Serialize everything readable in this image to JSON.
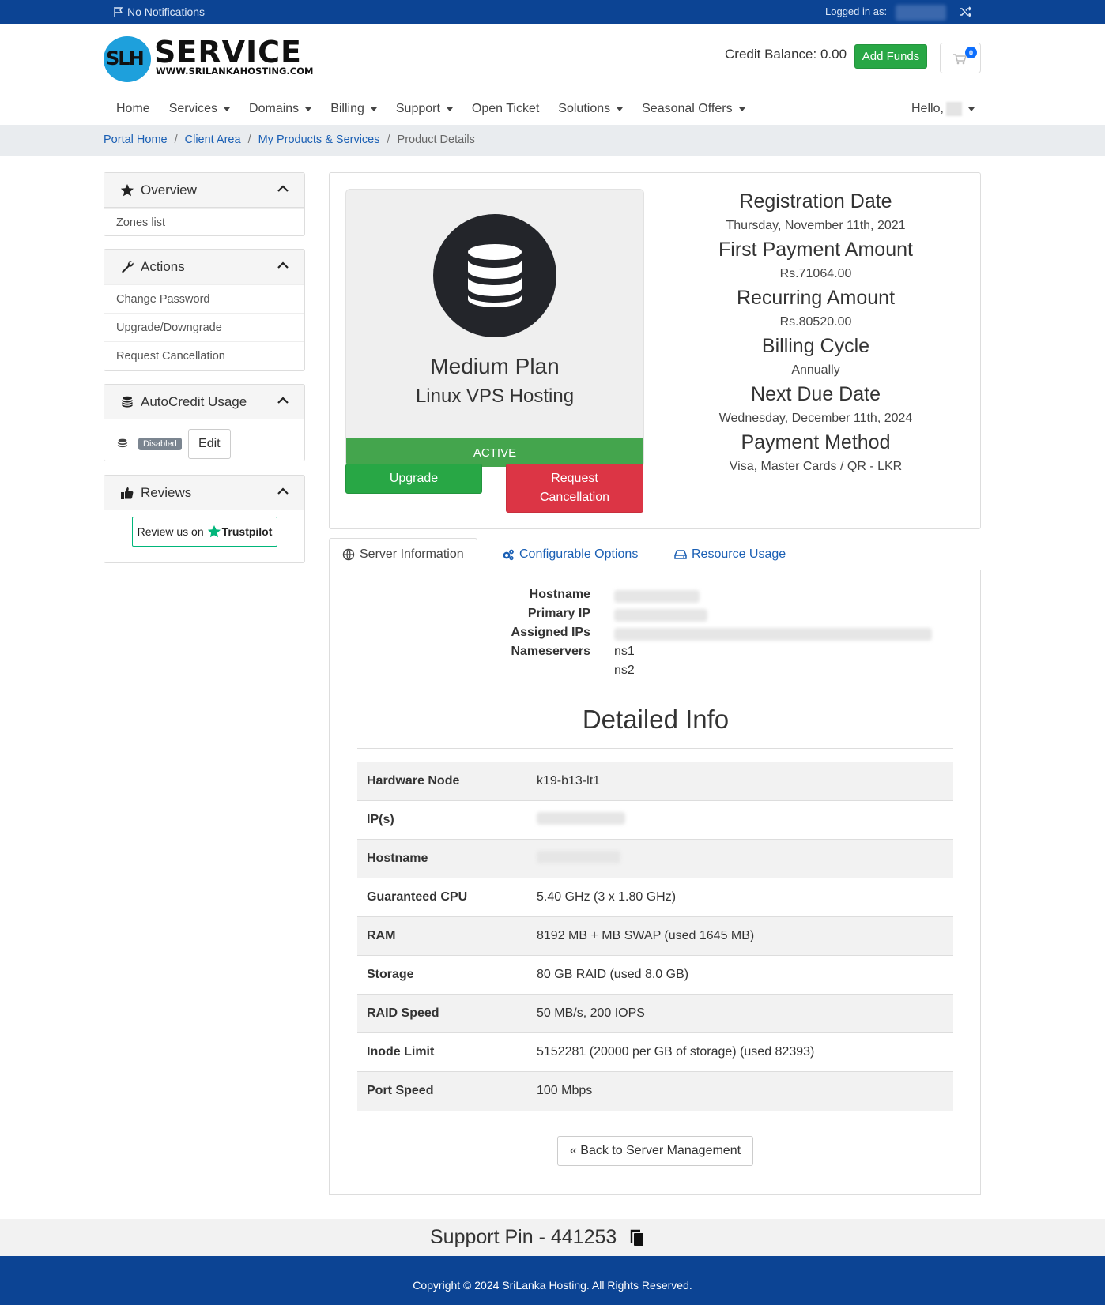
{
  "topbar": {
    "notifications": "No Notifications",
    "logged_in_as": "Logged in as:"
  },
  "brand": {
    "logo_initials": "SLH",
    "logo_word": "SERVICE",
    "logo_url": "WWW.SRILANKAHOSTING.COM"
  },
  "header": {
    "credit_balance": "Credit Balance: 0.00",
    "add_funds": "Add Funds",
    "cart_count": "0"
  },
  "nav": {
    "items": [
      {
        "label": "Home",
        "dropdown": false
      },
      {
        "label": "Services",
        "dropdown": true
      },
      {
        "label": "Domains",
        "dropdown": true
      },
      {
        "label": "Billing",
        "dropdown": true
      },
      {
        "label": "Support",
        "dropdown": true
      },
      {
        "label": "Open Ticket",
        "dropdown": false
      },
      {
        "label": "Solutions",
        "dropdown": true
      },
      {
        "label": "Seasonal Offers",
        "dropdown": true
      }
    ],
    "hello": "Hello,"
  },
  "breadcrumb": [
    "Portal Home",
    "Client Area",
    "My Products & Services",
    "Product Details"
  ],
  "sidebar": {
    "overview": {
      "title": "Overview",
      "items": [
        "Zones list"
      ]
    },
    "actions": {
      "title": "Actions",
      "items": [
        "Change Password",
        "Upgrade/Downgrade",
        "Request Cancellation"
      ]
    },
    "autocredit": {
      "title": "AutoCredit Usage",
      "badge": "Disabled",
      "edit": "Edit"
    },
    "reviews": {
      "title": "Reviews",
      "review_text": "Review us on",
      "trustpilot": "Trustpilot"
    }
  },
  "product": {
    "name": "Medium Plan",
    "group": "Linux VPS Hosting",
    "status": "ACTIVE",
    "upgrade": "Upgrade",
    "cancel": "Request Cancellation"
  },
  "registration": [
    {
      "label": "Registration Date",
      "value": "Thursday, November 11th, 2021"
    },
    {
      "label": "First Payment Amount",
      "value": "Rs.71064.00"
    },
    {
      "label": "Recurring Amount",
      "value": "Rs.80520.00"
    },
    {
      "label": "Billing Cycle",
      "value": "Annually"
    },
    {
      "label": "Next Due Date",
      "value": "Wednesday, December 11th, 2024"
    },
    {
      "label": "Payment Method",
      "value": "Visa, Master Cards / QR - LKR"
    }
  ],
  "tabs": [
    "Server Information",
    "Configurable Options",
    "Resource Usage"
  ],
  "server": {
    "hostname_label": "Hostname",
    "primary_ip_label": "Primary IP",
    "assigned_ips_label": "Assigned IPs",
    "nameservers_label": "Nameservers",
    "ns1": "ns1",
    "ns2": "ns2"
  },
  "detailed": {
    "title": "Detailed Info",
    "rows": [
      {
        "key": "Hardware Node",
        "value": "k19-b13-lt1"
      },
      {
        "key": "IP(s)",
        "value": ""
      },
      {
        "key": "Hostname",
        "value": ""
      },
      {
        "key": "Guaranteed CPU",
        "value": "5.40 GHz (3 x 1.80 GHz)"
      },
      {
        "key": "RAM",
        "value": "8192 MB + MB SWAP (used 1645 MB)"
      },
      {
        "key": "Storage",
        "value": "80 GB RAID (used 8.0 GB)"
      },
      {
        "key": "RAID Speed",
        "value": "50 MB/s, 200 IOPS"
      },
      {
        "key": "Inode Limit",
        "value": "5152281 (20000 per GB of storage) (used 82393)"
      },
      {
        "key": "Port Speed",
        "value": "100 Mbps"
      }
    ],
    "back": "« Back to Server Management"
  },
  "support_pin": "Support Pin - 441253",
  "footer": "Copyright © 2024 SriLanka Hosting. All Rights Reserved.",
  "colors": {
    "primary": "#0c4494",
    "success": "#28a745",
    "danger": "#dc3545",
    "link": "#1a5fb4"
  }
}
